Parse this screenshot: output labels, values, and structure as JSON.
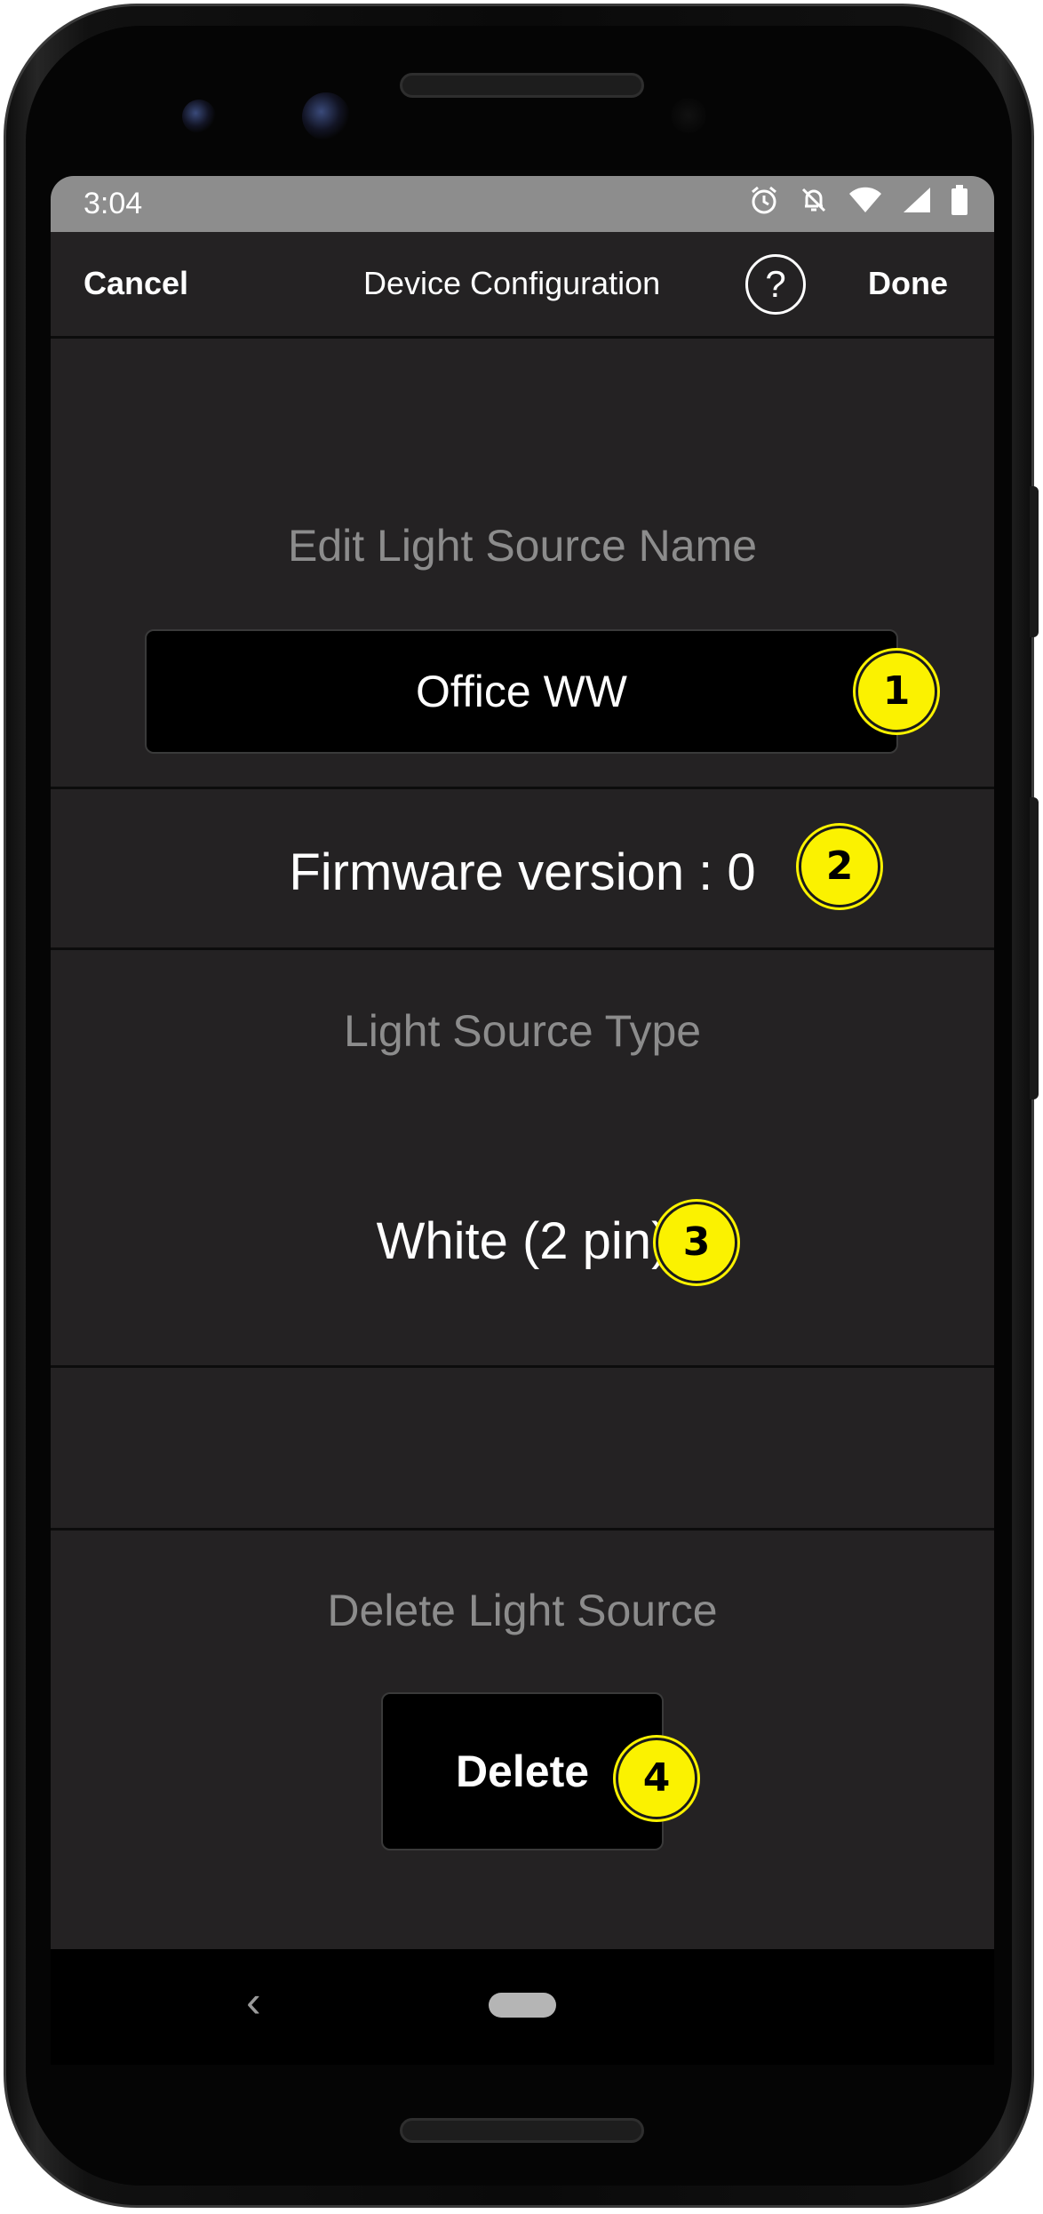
{
  "status_bar": {
    "time": "3:04",
    "icons": [
      "alarm-icon",
      "bell-off-icon",
      "wifi-icon",
      "signal-icon",
      "battery-icon"
    ]
  },
  "app_bar": {
    "cancel_label": "Cancel",
    "title": "Device Configuration",
    "help_label": "?",
    "done_label": "Done"
  },
  "name_section": {
    "label": "Edit Light Source Name",
    "value": "Office WW"
  },
  "firmware": {
    "text": "Firmware version : 0"
  },
  "type_section": {
    "label": "Light Source Type",
    "value": "White (2 pin)"
  },
  "delete_section": {
    "label": "Delete Light Source",
    "button_label": "Delete"
  },
  "nav_bar": {
    "back_glyph": "‹"
  },
  "callouts": [
    "1",
    "2",
    "3",
    "4"
  ],
  "colors": {
    "screen_bg": "#242223",
    "status_bar_bg": "#8d8d8d",
    "field_bg": "#000000",
    "callout_yellow": "#fbf200",
    "label_gray": "#8c8c8c"
  }
}
